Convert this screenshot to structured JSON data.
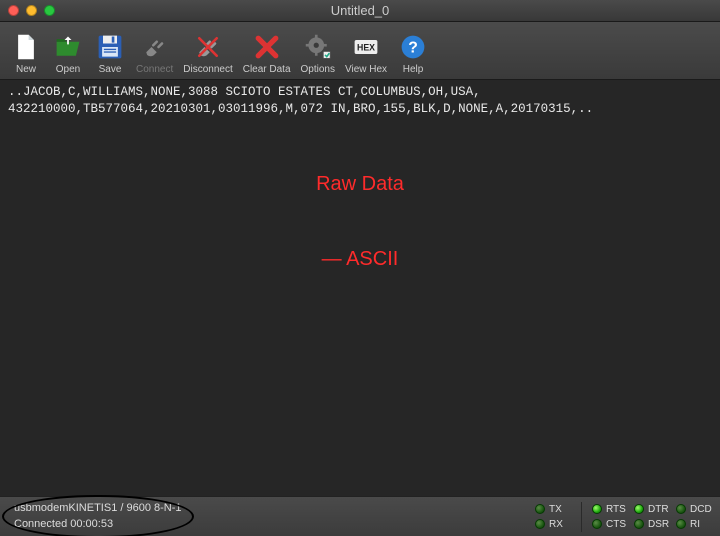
{
  "window": {
    "title": "Untitled_0"
  },
  "toolbar": {
    "new": "New",
    "open": "Open",
    "save": "Save",
    "connect": "Connect",
    "disconnect": "Disconnect",
    "clear": "Clear Data",
    "options": "Options",
    "viewhex": "View Hex",
    "help": "Help"
  },
  "terminal": {
    "line1": "..JACOB,C,WILLIAMS,NONE,3088 SCIOTO ESTATES CT,COLUMBUS,OH,USA,",
    "line2": "432210000,TB577064,20210301,03011996,M,072 IN,BRO,155,BLK,D,NONE,A,20170315,.."
  },
  "annotation": {
    "line1": "Raw Data",
    "line2": "— ASCII"
  },
  "status": {
    "port": "usbmodemKINETIS1 / 9600 8-N-1",
    "conn": "Connected 00:00:53",
    "signals": {
      "tx": "TX",
      "rx": "RX",
      "rts": "RTS",
      "cts": "CTS",
      "dtr": "DTR",
      "dsr": "DSR",
      "dcd": "DCD",
      "ri": "RI"
    }
  }
}
